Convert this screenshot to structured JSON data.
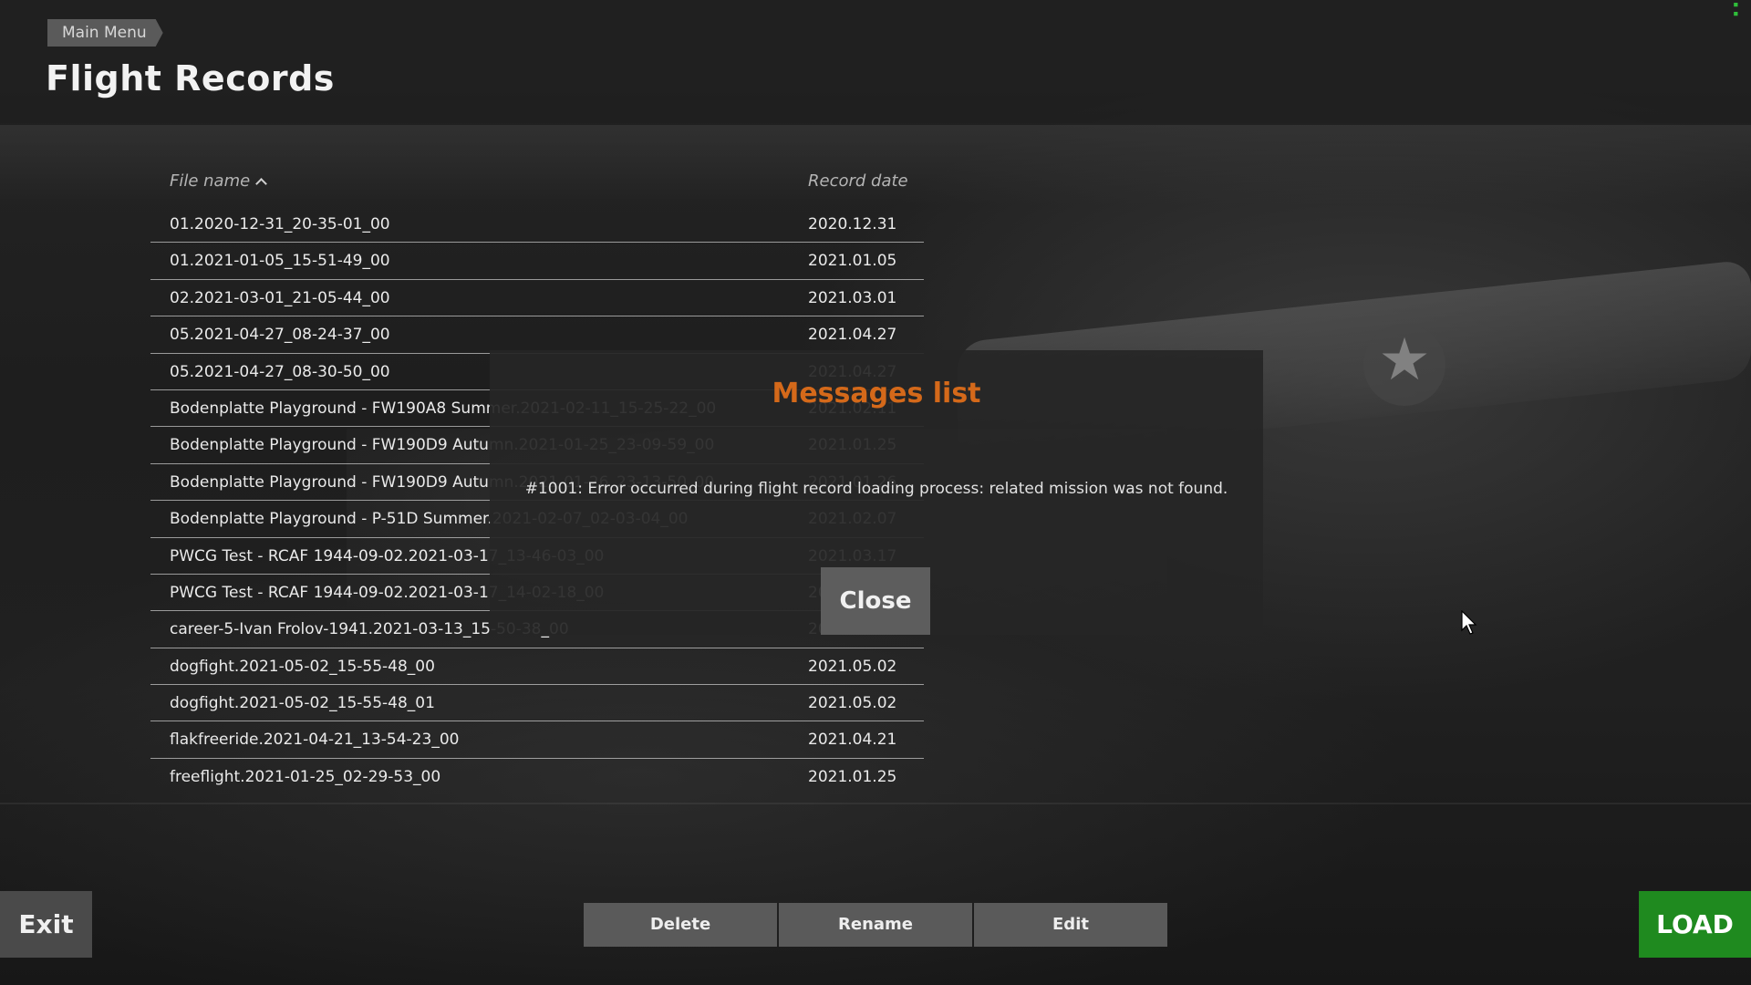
{
  "header": {
    "breadcrumb": "Main Menu",
    "title": "Flight Records"
  },
  "table": {
    "columns": {
      "name": "File name",
      "date": "Record date"
    },
    "sort": {
      "column": "name",
      "direction": "ascending"
    },
    "rows": [
      {
        "name": "01.2020-12-31_20-35-01_00",
        "date": "2020.12.31"
      },
      {
        "name": "01.2021-01-05_15-51-49_00",
        "date": "2021.01.05"
      },
      {
        "name": "02.2021-03-01_21-05-44_00",
        "date": "2021.03.01"
      },
      {
        "name": "05.2021-04-27_08-24-37_00",
        "date": "2021.04.27"
      },
      {
        "name": "05.2021-04-27_08-30-50_00",
        "date": "2021.04.27"
      },
      {
        "name": "Bodenplatte Playground - FW190A8 Summer.2021-02-11_15-25-22_00",
        "date": "2021.02.11"
      },
      {
        "name": "Bodenplatte Playground - FW190D9 Autumn.2021-01-25_23-09-59_00",
        "date": "2021.01.25"
      },
      {
        "name": "Bodenplatte Playground - FW190D9 Autumn.2021-01-26_23-13-50_00",
        "date": "2021.01.26"
      },
      {
        "name": "Bodenplatte Playground - P-51D Summer.2021-02-07_02-03-04_00",
        "date": "2021.02.07"
      },
      {
        "name": "PWCG Test - RCAF 1944-09-02.2021-03-17_13-46-03_00",
        "date": "2021.03.17"
      },
      {
        "name": "PWCG Test - RCAF 1944-09-02.2021-03-17_14-02-18_00",
        "date": "2021.03.17"
      },
      {
        "name": "career-5-Ivan Frolov-1941.2021-03-13_15-50-38_00",
        "date": "2021.03.13"
      },
      {
        "name": "dogfight.2021-05-02_15-55-48_00",
        "date": "2021.05.02"
      },
      {
        "name": "dogfight.2021-05-02_15-55-48_01",
        "date": "2021.05.02"
      },
      {
        "name": "flakfreeride.2021-04-21_13-54-23_00",
        "date": "2021.04.21"
      },
      {
        "name": "freeflight.2021-01-25_02-29-53_00",
        "date": "2021.01.25"
      }
    ]
  },
  "modal": {
    "title": "Messages list",
    "message": "#1001: Error occurred during flight record loading process: related mission was not found.",
    "close_label": "Close"
  },
  "footer": {
    "exit_label": "Exit",
    "delete_label": "Delete",
    "rename_label": "Rename",
    "edit_label": "Edit",
    "load_label": "LOAD"
  },
  "colors": {
    "accent_orange": "#d4691a",
    "load_green": "#1f8a1f",
    "fps_green": "#2fbf3a"
  },
  "icons": {
    "sort": "chevron-up-icon",
    "cursor": "mouse-pointer-icon",
    "star": "roundel-star-icon"
  }
}
